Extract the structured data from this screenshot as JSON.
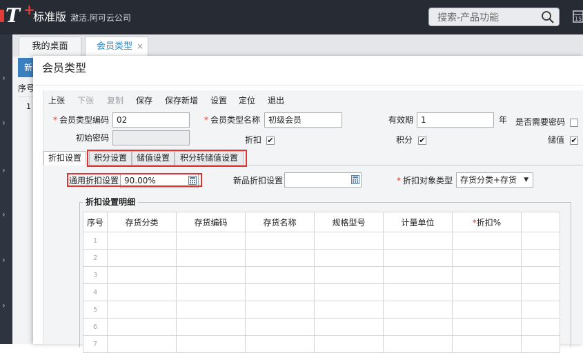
{
  "app": {
    "edition": "标准版",
    "company": "激活.阿可云公司",
    "search_placeholder": "搜索-产品功能",
    "brand_color": "#272b33",
    "accent_color": "#2b86c5",
    "highlight_color": "#e03434"
  },
  "tabs": [
    {
      "label": "我的桌面"
    },
    {
      "label": "会员类型",
      "close": "×"
    }
  ],
  "background_page": {
    "new_button": "新",
    "column_seq": "序号",
    "row1": "1"
  },
  "dialog": {
    "title": "会员类型",
    "toolbar": [
      {
        "label": "上张",
        "enabled": true
      },
      {
        "label": "下张",
        "enabled": false
      },
      {
        "label": "复制",
        "enabled": false
      },
      {
        "label": "保存",
        "enabled": true
      },
      {
        "label": "保存新增",
        "enabled": true
      },
      {
        "label": "设置",
        "enabled": true
      },
      {
        "label": "定位",
        "enabled": true
      },
      {
        "label": "退出",
        "enabled": true
      }
    ],
    "form": {
      "code_label": "会员类型编码",
      "code_value": "02",
      "name_label": "会员类型名称",
      "name_value": "初级会员",
      "validity_label": "有效期",
      "validity_value": "1",
      "validity_unit": "年",
      "need_password_label": "是否需要密码",
      "need_password_checked": false,
      "init_password_label": "初始密码",
      "init_password_value": "",
      "discount_label": "折扣",
      "discount_checked": true,
      "points_label": "积分",
      "points_checked": true,
      "stored_value_label": "储值",
      "stored_value_checked": true,
      "required_mark": "*",
      "check_mark": "✔"
    },
    "subtabs": [
      "折扣设置",
      "积分设置",
      "储值设置",
      "积分转储值设置"
    ],
    "discount": {
      "general_label": "通用折扣设置",
      "general_value": "90.00%",
      "new_product_label": "新品折扣设置",
      "new_product_value": "",
      "target_type_label": "折扣对象类型",
      "target_type_value": "存货分类+存货"
    },
    "detail": {
      "legend": "折扣设置明细",
      "columns": [
        "序号",
        "存货分类",
        "存货编码",
        "存货名称",
        "规格型号",
        "计量单位",
        "*折扣%",
        ""
      ],
      "rows": [
        "1",
        "2",
        "3",
        "4",
        "5",
        "6",
        "7"
      ]
    }
  }
}
